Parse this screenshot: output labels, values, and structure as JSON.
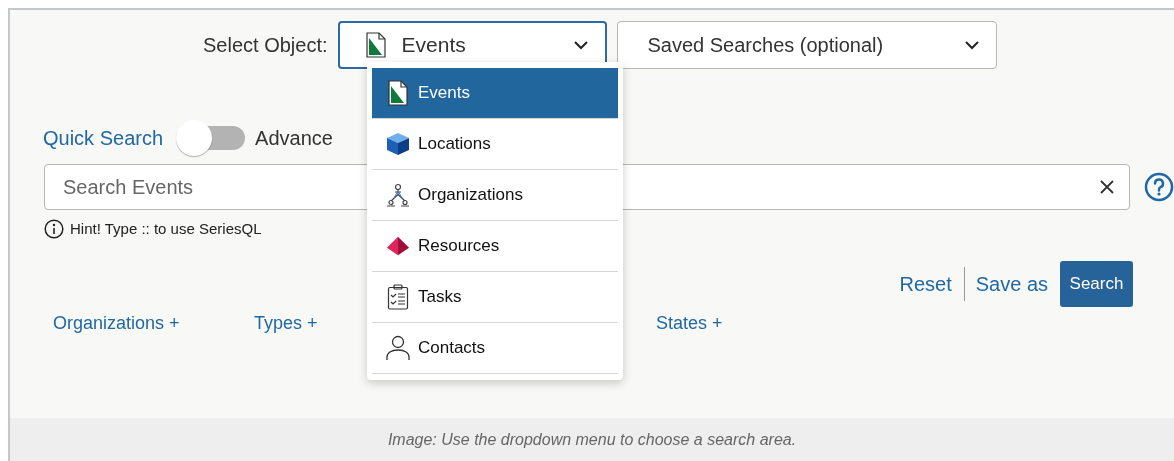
{
  "object_selector": {
    "label": "Select Object:",
    "value": "Events",
    "kind": "events",
    "expanded": true
  },
  "saved_searches": {
    "value": "Saved Searches (optional)"
  },
  "object_menu": [
    {
      "label": "Events",
      "kind": "events",
      "selected": true
    },
    {
      "label": "Locations",
      "kind": "locations",
      "selected": false
    },
    {
      "label": "Organizations",
      "kind": "organizations",
      "selected": false
    },
    {
      "label": "Resources",
      "kind": "resources",
      "selected": false
    },
    {
      "label": "Tasks",
      "kind": "tasks",
      "selected": false
    },
    {
      "label": "Contacts",
      "kind": "contacts",
      "selected": false
    }
  ],
  "search_mode": {
    "left_label": "Quick Search",
    "right_label": "Advance",
    "on": false
  },
  "search_field": {
    "placeholder": "Search Events"
  },
  "hint": "Hint! Type :: to use SeriesQL",
  "actions": {
    "reset": "Reset",
    "save_as": "Save as",
    "search": "Search"
  },
  "filters": [
    {
      "label": "Organizations +"
    },
    {
      "label": "Types +"
    },
    {
      "label": "States +"
    }
  ],
  "caption": "Image: Use the dropdown menu to choose a search area."
}
